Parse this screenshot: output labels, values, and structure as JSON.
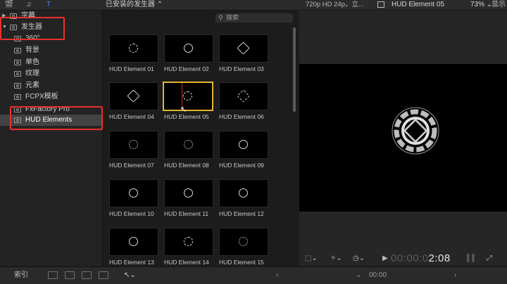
{
  "topbar": {
    "library_title": "已安装的发生器 ⌃",
    "video_format": "720p HD 24p，立...",
    "clip_name": "HUD Element 05",
    "zoom": "73% ⌄",
    "view_menu": "显示 ⌄"
  },
  "sidebar": {
    "items": [
      {
        "label": "字幕"
      },
      {
        "label": "发生器"
      },
      {
        "label": "360°"
      },
      {
        "label": "背景"
      },
      {
        "label": "单色"
      },
      {
        "label": "纹理"
      },
      {
        "label": "元素"
      },
      {
        "label": "FCPX模板"
      },
      {
        "label": "FxFactory Pro"
      },
      {
        "label": "HUD Elements"
      }
    ]
  },
  "browser": {
    "search_placeholder": "搜索",
    "tiles": [
      {
        "label": "HUD Element 01"
      },
      {
        "label": "HUD Element 02"
      },
      {
        "label": "HUD Element 03"
      },
      {
        "label": "HUD Element 04"
      },
      {
        "label": "HUD Element 05"
      },
      {
        "label": "HUD Element 06"
      },
      {
        "label": "HUD Element 07"
      },
      {
        "label": "HUD Element 08"
      },
      {
        "label": "HUD Element 09"
      },
      {
        "label": "HUD Element 10"
      },
      {
        "label": "HUD Element 11"
      },
      {
        "label": "HUD Element 12"
      },
      {
        "label": "HUD Element 13"
      },
      {
        "label": "HUD Element 14"
      },
      {
        "label": "HUD Element 15"
      }
    ]
  },
  "viewer": {
    "timecode_dim": "00:00:0",
    "timecode_bright": "2:08"
  },
  "bottombar": {
    "index_label": "索引",
    "timeline_time": "00:00"
  }
}
